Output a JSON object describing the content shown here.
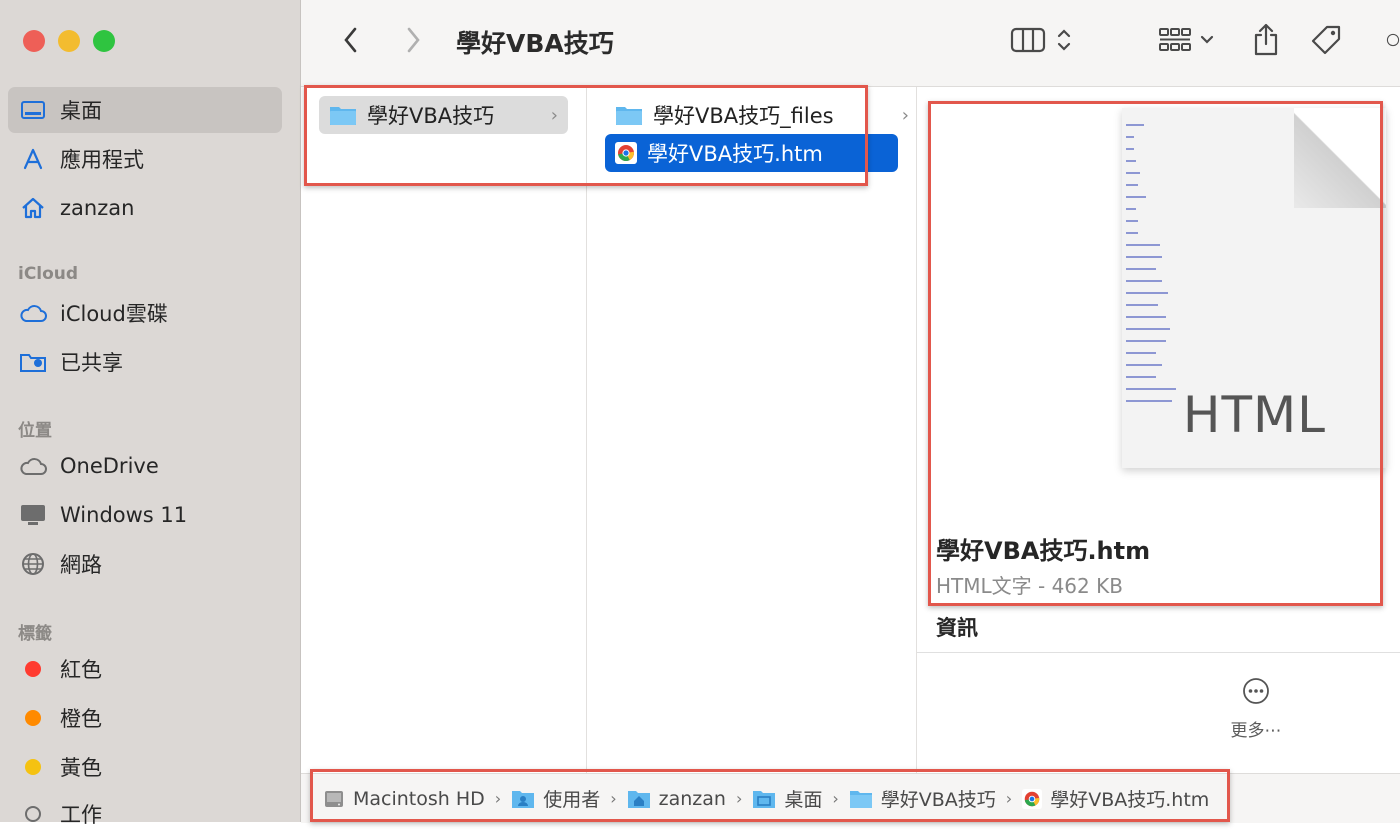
{
  "window": {
    "title": "學好VBA技巧"
  },
  "sidebar": {
    "favorites": [
      {
        "label": "桌面",
        "icon": "desktop-icon",
        "selected": true
      },
      {
        "label": "應用程式",
        "icon": "applications-icon"
      },
      {
        "label": "zanzan",
        "icon": "home-icon"
      }
    ],
    "icloud_header": "iCloud",
    "icloud": [
      {
        "label": "iCloud雲碟",
        "icon": "cloud-icon"
      },
      {
        "label": "已共享",
        "icon": "shared-folder-icon"
      }
    ],
    "locations_header": "位置",
    "locations": [
      {
        "label": "OneDrive",
        "icon": "cloud-icon"
      },
      {
        "label": "Windows 11",
        "icon": "display-icon"
      },
      {
        "label": "網路",
        "icon": "globe-icon"
      }
    ],
    "tags_header": "標籤",
    "tags": [
      {
        "label": "紅色",
        "color": "#ff3b30"
      },
      {
        "label": "橙色",
        "color": "#ff8a00"
      },
      {
        "label": "黃色",
        "color": "#f5c211"
      },
      {
        "label": "工作",
        "color": "hollow"
      }
    ]
  },
  "columns": {
    "col1": [
      {
        "label": "學好VBA技巧",
        "type": "folder",
        "state": "parent-selected"
      }
    ],
    "col2": [
      {
        "label": "學好VBA技巧_files",
        "type": "folder"
      },
      {
        "label": "學好VBA技巧.htm",
        "type": "html-file",
        "state": "selected"
      }
    ]
  },
  "preview": {
    "badge": "HTML",
    "filename": "學好VBA技巧.htm",
    "kind": "HTML文字 - 462 KB",
    "info_heading": "資訊",
    "more_label": "更多⋯"
  },
  "pathbar": [
    {
      "label": "Macintosh HD",
      "icon": "hard-drive-icon"
    },
    {
      "label": "使用者",
      "icon": "users-folder-icon"
    },
    {
      "label": "zanzan",
      "icon": "home-folder-icon"
    },
    {
      "label": "桌面",
      "icon": "desktop-folder-icon"
    },
    {
      "label": "學好VBA技巧",
      "icon": "folder-icon"
    },
    {
      "label": "學好VBA技巧.htm",
      "icon": "chrome-icon"
    }
  ],
  "colors": {
    "selection": "#0a63d6",
    "highlight_box": "#e2574c",
    "sidebar_bg": "#dcd8d5"
  }
}
